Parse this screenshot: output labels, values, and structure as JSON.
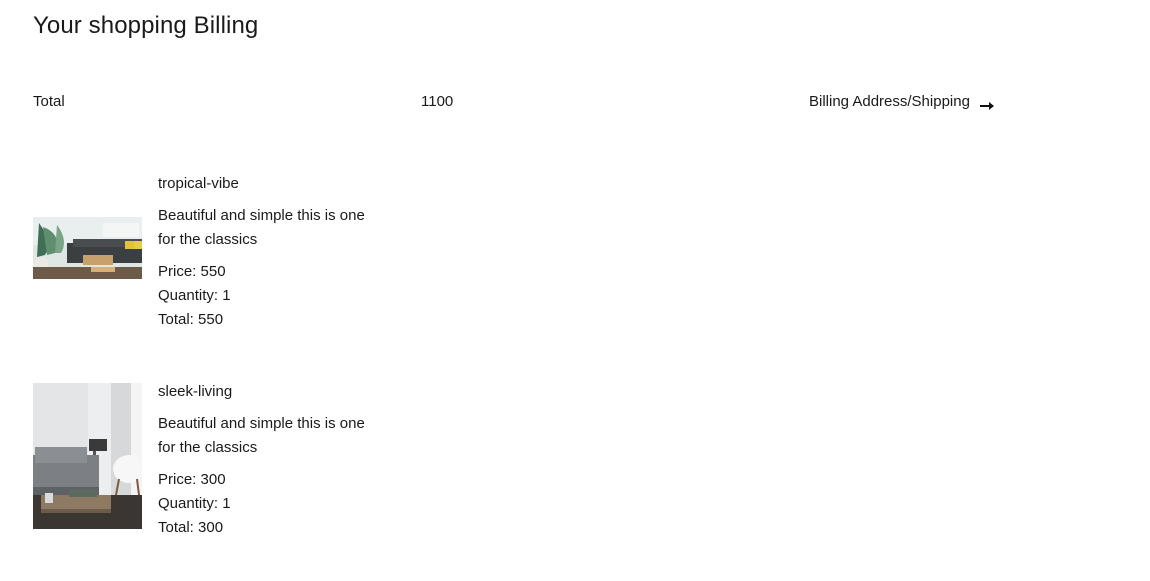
{
  "header": {
    "title": "Your shopping Billing"
  },
  "summary": {
    "label": "Total",
    "total": "1100",
    "link_label": "Billing Address/Shipping",
    "link_icon": "arrow-right-icon"
  },
  "items": [
    {
      "name": "tropical-vibe",
      "description": "Beautiful and simple this is one for the classics",
      "price": "Price: 550",
      "quantity": "Quantity: 1",
      "total": "Total: 550"
    },
    {
      "name": "sleek-living",
      "description": "Beautiful and simple this is one for the classics",
      "price": "Price: 300",
      "quantity": "Quantity: 1",
      "total": "Total: 300"
    }
  ]
}
